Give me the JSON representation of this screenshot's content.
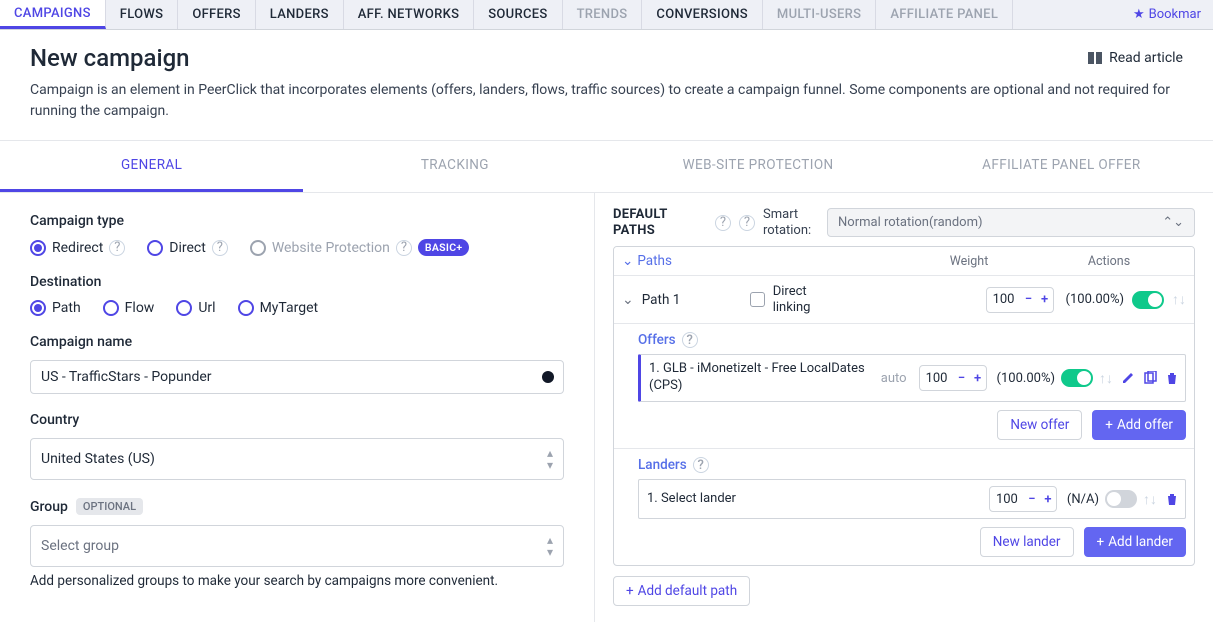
{
  "topnav": {
    "campaigns": "CAMPAIGNS",
    "flows": "FLOWS",
    "offers": "OFFERS",
    "landers": "LANDERS",
    "aff": "AFF. NETWORKS",
    "sources": "SOURCES",
    "trends": "TRENDS",
    "conversions": "CONVERSIONS",
    "multi": "MULTI-USERS",
    "panel": "AFFILIATE PANEL"
  },
  "bookmark": "Bookmar",
  "intro": {
    "title": "New campaign",
    "read": "Read article",
    "desc": "Campaign is an element in PeerClick that incorporates elements (offers, landers, flows, traffic sources) to create a campaign funnel. Some components are optional and not required for running the campaign."
  },
  "subtabs": {
    "general": "GENERAL",
    "tracking": "TRACKING",
    "wsp": "WEB-SITE PROTECTION",
    "apo": "AFFILIATE PANEL OFFER"
  },
  "left": {
    "ctypeLabel": "Campaign type",
    "ctype": {
      "redirect": "Redirect",
      "direct": "Direct",
      "wp": "Website Protection",
      "badge": "BASIC+"
    },
    "destLabel": "Destination",
    "dest": {
      "path": "Path",
      "flow": "Flow",
      "url": "Url",
      "mytarget": "MyTarget"
    },
    "nameLabel": "Campaign name",
    "name": "US - TrafficStars - Popunder",
    "countryLabel": "Country",
    "country": "United States (US)",
    "groupLabel": "Group",
    "optional": "OPTIONAL",
    "group": "Select group",
    "groupNote": "Add personalized groups to make your search by campaigns more convenient."
  },
  "right": {
    "dpTitle": "DEFAULT PATHS",
    "smart": "Smart rotation:",
    "rotation": "Normal rotation(random)",
    "paths": "Paths",
    "weight": "Weight",
    "actions": "Actions",
    "path1": "Path 1",
    "dl": "Direct linking",
    "w100": "100",
    "pct100": "(100.00%)",
    "offers": "Offers",
    "offerName": "1. GLB - iMonetizeIt - Free LocalDates (CPS)",
    "auto": "auto",
    "newOffer": "New offer",
    "addOffer": "Add offer",
    "landers": "Landers",
    "landerName": "1. Select lander",
    "na": "(N/A)",
    "newLander": "New lander",
    "addLander": "Add lander",
    "addDP": "Add default path"
  }
}
